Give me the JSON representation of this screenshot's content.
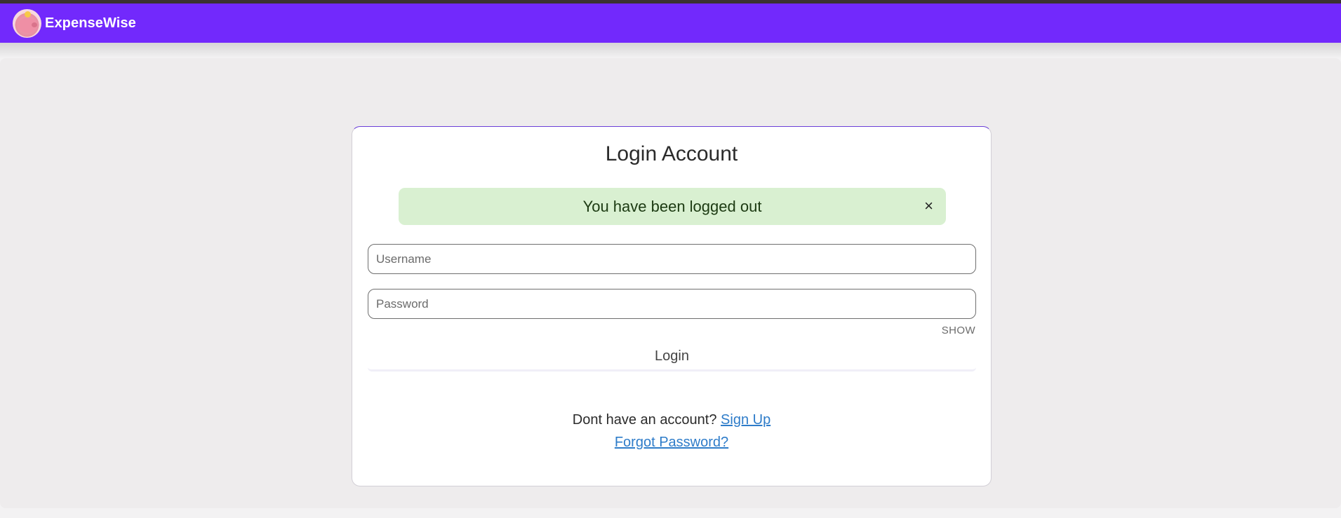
{
  "app": {
    "brand": "ExpenseWise",
    "logo_icon": "piggy-bank-icon"
  },
  "colors": {
    "navbar": "#7229fc",
    "alert_background": "#d9f0d1",
    "link": "#2e7cc9"
  },
  "login": {
    "title": "Login Account",
    "alert_message": "You have been logged out",
    "alert_close": "×",
    "username_placeholder": "Username",
    "username_value": "",
    "password_placeholder": "Password",
    "password_value": "",
    "show_label": "SHOW",
    "login_button": "Login",
    "no_account_text": "Dont have an account?",
    "signup_link": "Sign Up",
    "forgot_link": "Forgot Password?"
  }
}
